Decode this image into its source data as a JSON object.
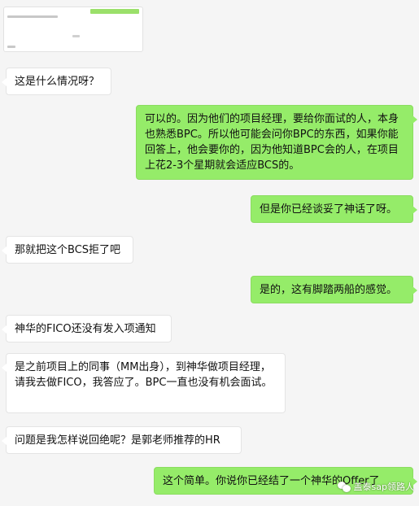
{
  "messages": [
    {
      "side": "left",
      "text": "这是什么情况呀？"
    },
    {
      "side": "right",
      "text": "可以的。因为他们的项目经理，要给你面试的人，本身也熟悉BPC。所以他可能会问你BPC的东西，如果你能回答上，他会要你的，因为他知道BPC会的人，在项目上花2-3个星期就会适应BCS的。"
    },
    {
      "side": "right",
      "text": "但是你已经谈妥了神话了呀。"
    },
    {
      "side": "left",
      "text": "那就把这个BCS拒了吧"
    },
    {
      "side": "right",
      "text": "是的，这有脚踏两船的感觉。"
    },
    {
      "side": "left",
      "text": "神华的FICO还没有发入项通知"
    },
    {
      "side": "left",
      "text": "是之前项目上的同事（MM出身），到神华做项目经理，请我去做FICO，我答应了。BPC一直也没有机会面试。"
    },
    {
      "side": "left",
      "text": "问题是我怎样说回绝呢？是郭老师推荐的HR"
    },
    {
      "side": "right",
      "text": "这个简单。你说你已经结了一个神华的Offer了"
    }
  ],
  "watermark": {
    "text": "盖泰sap领路人"
  }
}
